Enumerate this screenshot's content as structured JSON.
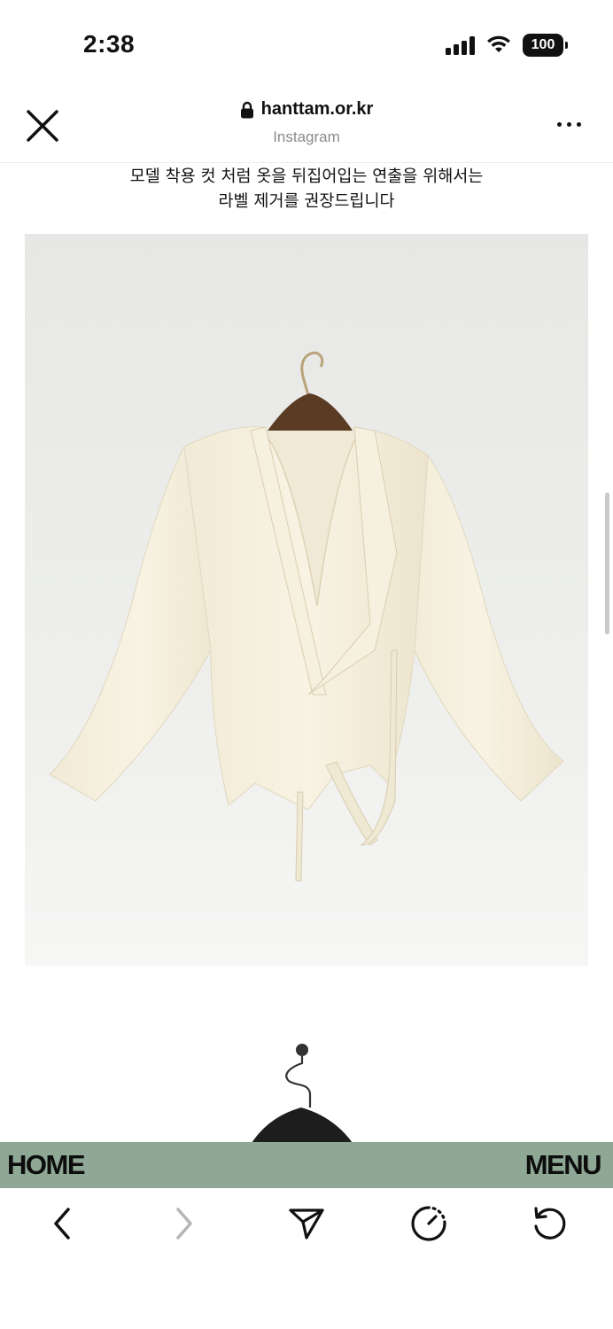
{
  "status_bar": {
    "time": "2:38",
    "battery": "100",
    "icons": [
      "signal-icon",
      "wifi-icon",
      "battery-icon"
    ]
  },
  "browser": {
    "domain": "hanttam.or.kr",
    "source": "Instagram",
    "icons": [
      "close-icon",
      "lock-icon",
      "more-icon"
    ]
  },
  "content": {
    "caption_line1": "모델 착용 컷 처럼 옷을 뒤집어입는 연출을 위해서는",
    "caption_line2": "라벨 제거를 권장드립니다",
    "images": [
      "cream cardigan on wooden hanger",
      "second product photo on hanger"
    ]
  },
  "site_nav": {
    "home_label": "HOME",
    "menu_label": "MENU",
    "background": "#8ea895"
  },
  "toolbar": {
    "icons": [
      "back-icon",
      "forward-icon",
      "share-icon",
      "timer-icon",
      "reload-icon"
    ]
  }
}
